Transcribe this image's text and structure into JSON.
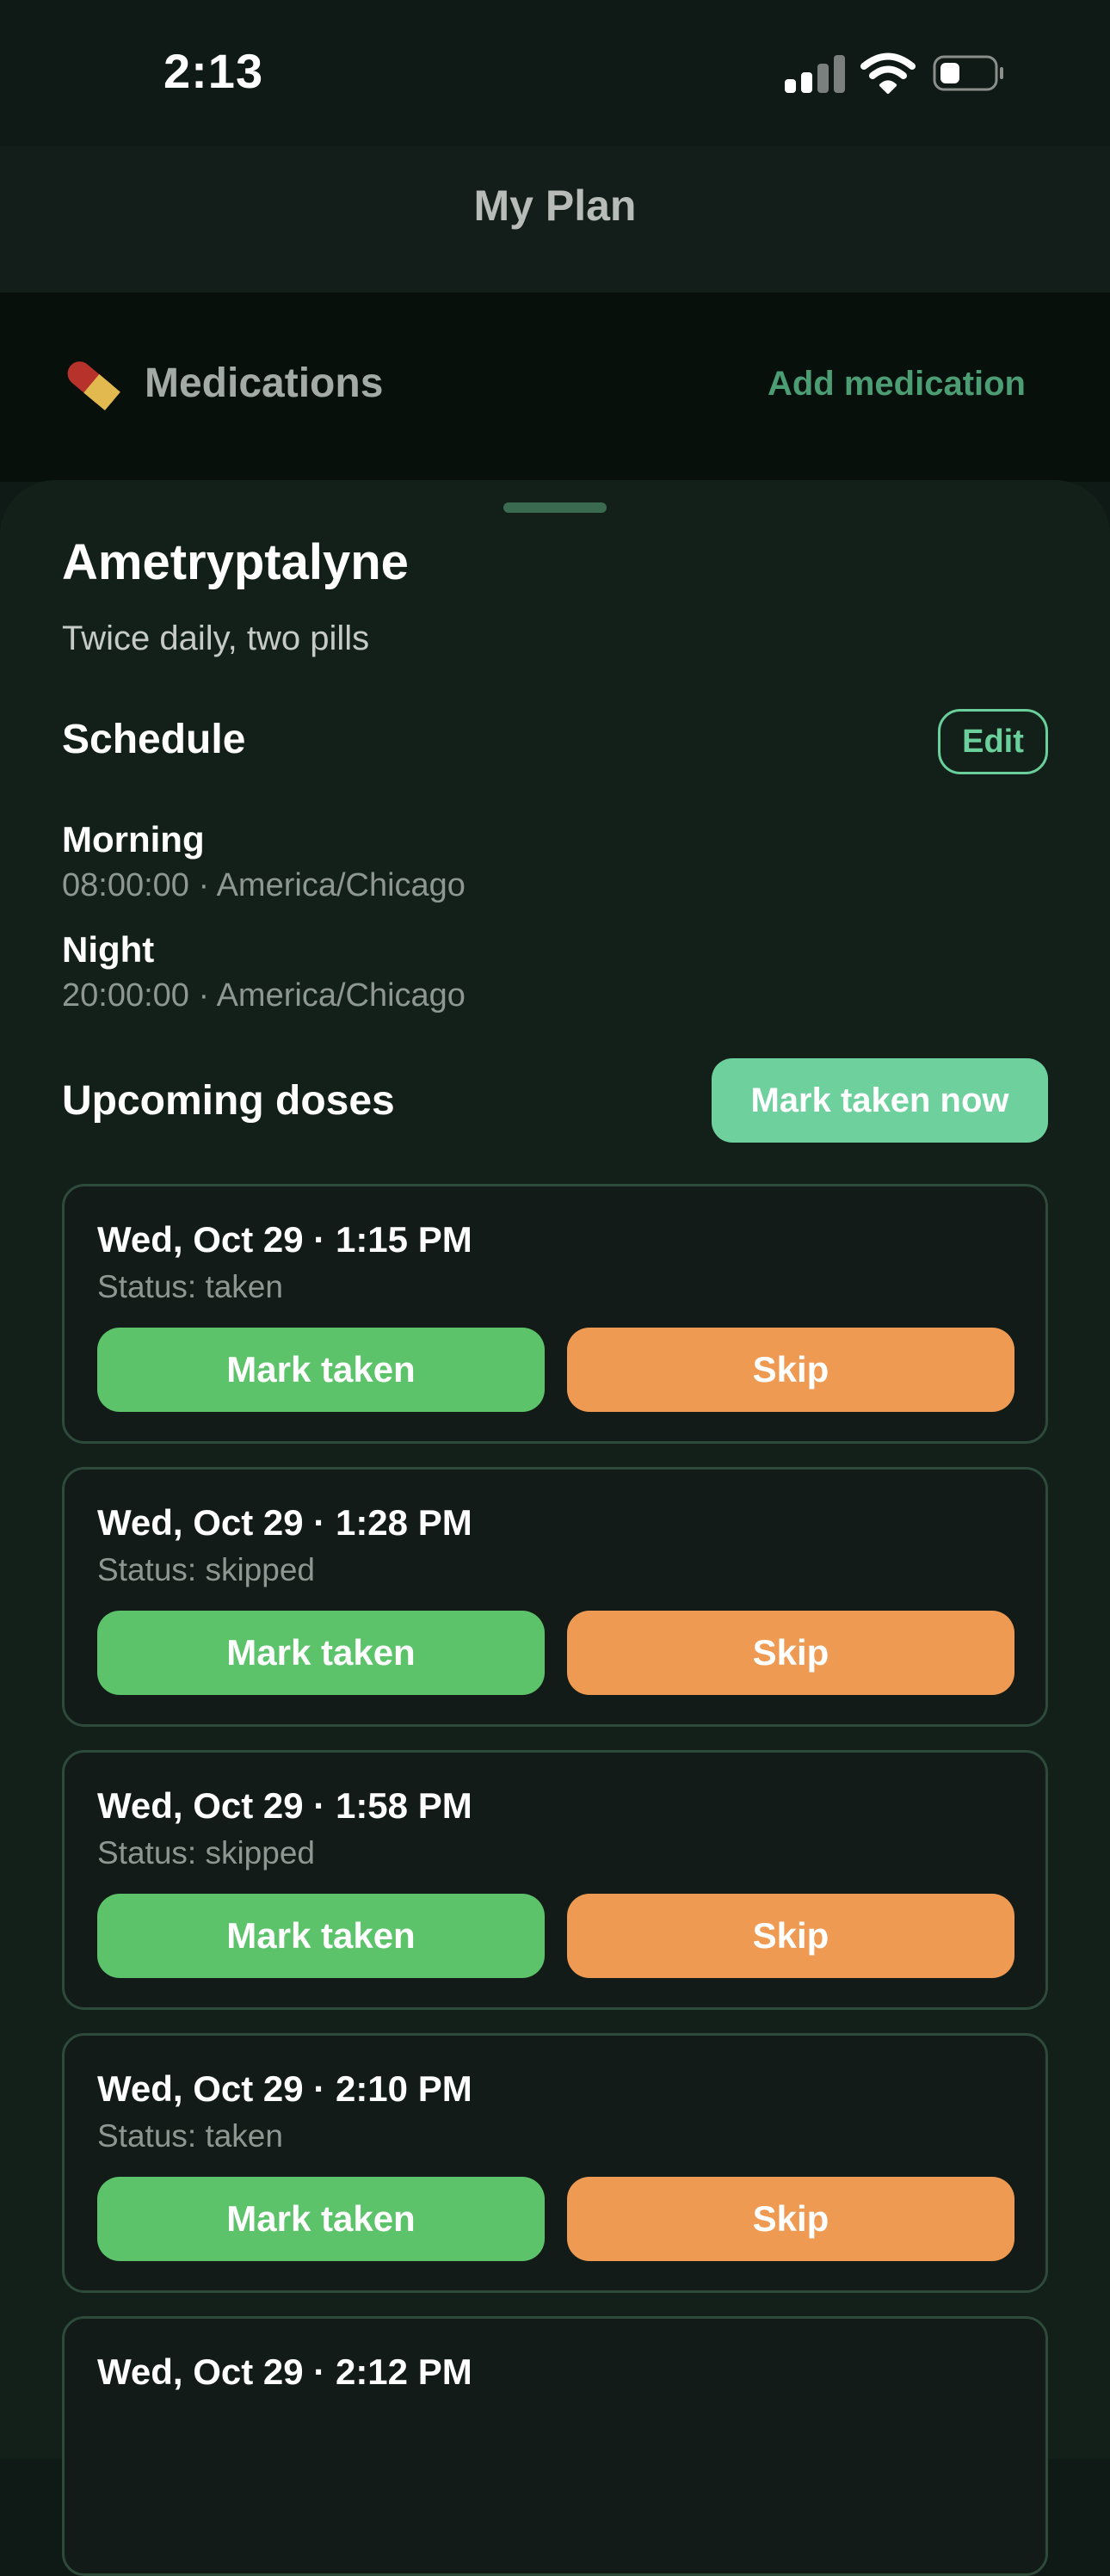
{
  "status_bar": {
    "time": "2:13"
  },
  "nav": {
    "title": "My Plan"
  },
  "medications_section": {
    "heading": "Medications",
    "add_label": "Add medication"
  },
  "medication": {
    "name": "Ametryptalyne",
    "description": "Twice daily, two pills"
  },
  "schedule": {
    "title": "Schedule",
    "edit_label": "Edit",
    "entries": [
      {
        "label": "Morning",
        "time": "08:00:00 · America/Chicago"
      },
      {
        "label": "Night",
        "time": "20:00:00 · America/Chicago"
      }
    ]
  },
  "upcoming": {
    "title": "Upcoming doses",
    "mark_now_label": "Mark taken now",
    "doses": [
      {
        "date": "Wed, Oct 29 · 1:15 PM",
        "status": "Status: taken",
        "taken_label": "Mark taken",
        "skip_label": "Skip"
      },
      {
        "date": "Wed, Oct 29 · 1:28 PM",
        "status": "Status: skipped",
        "taken_label": "Mark taken",
        "skip_label": "Skip"
      },
      {
        "date": "Wed, Oct 29 · 1:58 PM",
        "status": "Status: skipped",
        "taken_label": "Mark taken",
        "skip_label": "Skip"
      },
      {
        "date": "Wed, Oct 29 · 2:10 PM",
        "status": "Status: taken",
        "taken_label": "Mark taken",
        "skip_label": "Skip"
      },
      {
        "date": "Wed, Oct 29 · 2:12 PM"
      }
    ]
  },
  "colors": {
    "accent": "#6dd09d",
    "taken_button": "#5dc36b",
    "skip_button": "#ef9a52",
    "background": "#0f1915"
  },
  "icons": [
    "signal-icon",
    "wifi-icon",
    "battery-icon",
    "pill-icon"
  ]
}
